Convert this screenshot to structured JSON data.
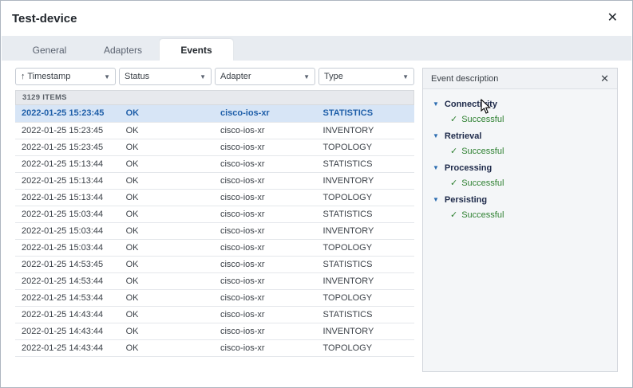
{
  "dialog": {
    "title": "Test-device",
    "close_icon": "✕"
  },
  "tabs": [
    {
      "label": "General",
      "active": false
    },
    {
      "label": "Adapters",
      "active": false
    },
    {
      "label": "Events",
      "active": true
    }
  ],
  "table": {
    "filters": [
      {
        "label": "↑ Timestamp",
        "key": "timestamp"
      },
      {
        "label": "Status",
        "key": "status"
      },
      {
        "label": "Adapter",
        "key": "adapter"
      },
      {
        "label": "Type",
        "key": "type"
      }
    ],
    "items_count": "3129 ITEMS",
    "rows": [
      {
        "timestamp": "2022-01-25 15:23:45",
        "status": "OK",
        "adapter": "cisco-ios-xr",
        "type": "STATISTICS",
        "selected": true
      },
      {
        "timestamp": "2022-01-25 15:23:45",
        "status": "OK",
        "adapter": "cisco-ios-xr",
        "type": "INVENTORY",
        "selected": false
      },
      {
        "timestamp": "2022-01-25 15:23:45",
        "status": "OK",
        "adapter": "cisco-ios-xr",
        "type": "TOPOLOGY",
        "selected": false
      },
      {
        "timestamp": "2022-01-25 15:13:44",
        "status": "OK",
        "adapter": "cisco-ios-xr",
        "type": "STATISTICS",
        "selected": false
      },
      {
        "timestamp": "2022-01-25 15:13:44",
        "status": "OK",
        "adapter": "cisco-ios-xr",
        "type": "INVENTORY",
        "selected": false
      },
      {
        "timestamp": "2022-01-25 15:13:44",
        "status": "OK",
        "adapter": "cisco-ios-xr",
        "type": "TOPOLOGY",
        "selected": false
      },
      {
        "timestamp": "2022-01-25 15:03:44",
        "status": "OK",
        "adapter": "cisco-ios-xr",
        "type": "STATISTICS",
        "selected": false
      },
      {
        "timestamp": "2022-01-25 15:03:44",
        "status": "OK",
        "adapter": "cisco-ios-xr",
        "type": "INVENTORY",
        "selected": false
      },
      {
        "timestamp": "2022-01-25 15:03:44",
        "status": "OK",
        "adapter": "cisco-ios-xr",
        "type": "TOPOLOGY",
        "selected": false
      },
      {
        "timestamp": "2022-01-25 14:53:45",
        "status": "OK",
        "adapter": "cisco-ios-xr",
        "type": "STATISTICS",
        "selected": false
      },
      {
        "timestamp": "2022-01-25 14:53:44",
        "status": "OK",
        "adapter": "cisco-ios-xr",
        "type": "INVENTORY",
        "selected": false
      },
      {
        "timestamp": "2022-01-25 14:53:44",
        "status": "OK",
        "adapter": "cisco-ios-xr",
        "type": "TOPOLOGY",
        "selected": false
      },
      {
        "timestamp": "2022-01-25 14:43:44",
        "status": "OK",
        "adapter": "cisco-ios-xr",
        "type": "STATISTICS",
        "selected": false
      },
      {
        "timestamp": "2022-01-25 14:43:44",
        "status": "OK",
        "adapter": "cisco-ios-xr",
        "type": "INVENTORY",
        "selected": false
      },
      {
        "timestamp": "2022-01-25 14:43:44",
        "status": "OK",
        "adapter": "cisco-ios-xr",
        "type": "TOPOLOGY",
        "selected": false
      }
    ]
  },
  "event_panel": {
    "title": "Event description",
    "close_icon": "✕",
    "expand_icon": "▼",
    "check_icon": "✓",
    "sections": [
      {
        "label": "Connectivity",
        "status": "Successful"
      },
      {
        "label": "Retrieval",
        "status": "Successful"
      },
      {
        "label": "Processing",
        "status": "Successful"
      },
      {
        "label": "Persisting",
        "status": "Successful"
      }
    ]
  },
  "colors": {
    "selected_row_bg": "#d7e5f6",
    "selected_row_text": "#1f5fa9",
    "success_green": "#2f8132",
    "section_navy": "#1e2a4a",
    "accent_blue": "#2b6cb0"
  }
}
